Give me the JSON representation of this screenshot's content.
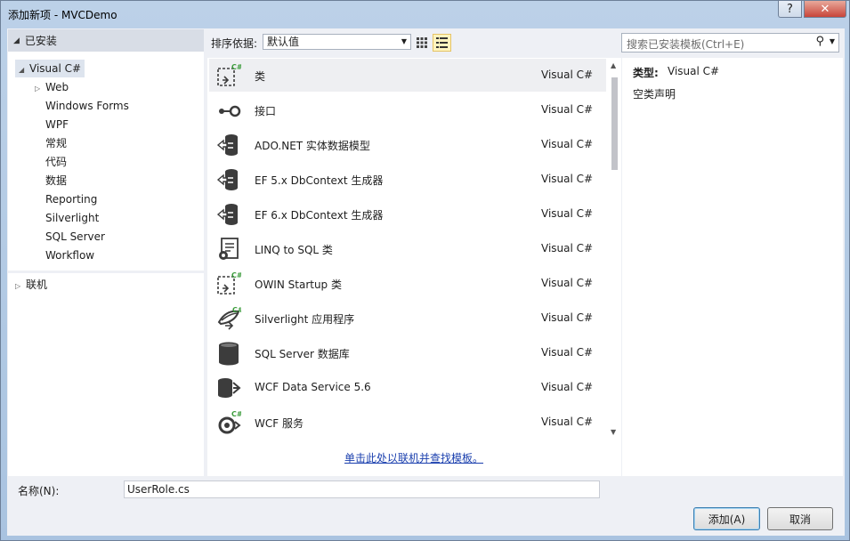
{
  "window": {
    "title": "添加新项 - MVCDemo",
    "help_label": "?",
    "close_label": "✕"
  },
  "left_pane": {
    "header": "已安装",
    "tree": [
      {
        "label": "Visual C#",
        "expanded": true,
        "selected": true
      },
      {
        "label": "Web",
        "collapsed": true
      },
      {
        "label": "Windows Forms"
      },
      {
        "label": "WPF"
      },
      {
        "label": "常规"
      },
      {
        "label": "代码"
      },
      {
        "label": "数据"
      },
      {
        "label": "Reporting"
      },
      {
        "label": "Silverlight"
      },
      {
        "label": "SQL Server"
      },
      {
        "label": "Workflow"
      }
    ],
    "online": "联机"
  },
  "toolbar": {
    "sort_label": "排序依据:",
    "sort_value": "默认值"
  },
  "templates": [
    {
      "name": "类",
      "lang": "Visual C#",
      "icon": "class-icon",
      "selected": true
    },
    {
      "name": "接口",
      "lang": "Visual C#",
      "icon": "interface-icon"
    },
    {
      "name": "ADO.NET 实体数据模型",
      "lang": "Visual C#",
      "icon": "entity-model-icon"
    },
    {
      "name": "EF 5.x DbContext 生成器",
      "lang": "Visual C#",
      "icon": "entity-model-icon"
    },
    {
      "name": "EF 6.x DbContext 生成器",
      "lang": "Visual C#",
      "icon": "entity-model-icon"
    },
    {
      "name": "LINQ to SQL 类",
      "lang": "Visual C#",
      "icon": "linq-icon"
    },
    {
      "name": "OWIN Startup 类",
      "lang": "Visual C#",
      "icon": "class-icon"
    },
    {
      "name": "Silverlight 应用程序",
      "lang": "Visual C#",
      "icon": "silverlight-icon"
    },
    {
      "name": "SQL Server 数据库",
      "lang": "Visual C#",
      "icon": "database-icon"
    },
    {
      "name": "WCF Data Service 5.6",
      "lang": "Visual C#",
      "icon": "data-service-icon"
    },
    {
      "name": "WCF 服务",
      "lang": "Visual C#",
      "icon": "wcf-service-icon"
    }
  ],
  "online_link": "单击此处以联机并查找模板。",
  "search": {
    "placeholder": "搜索已安装模板(Ctrl+E)"
  },
  "details": {
    "type_label": "类型:",
    "type_value": "Visual C#",
    "description": "空类声明"
  },
  "footer": {
    "name_label": "名称(N):",
    "name_value": "UserRole.cs",
    "add_label": "添加(A)",
    "cancel_label": "取消"
  }
}
